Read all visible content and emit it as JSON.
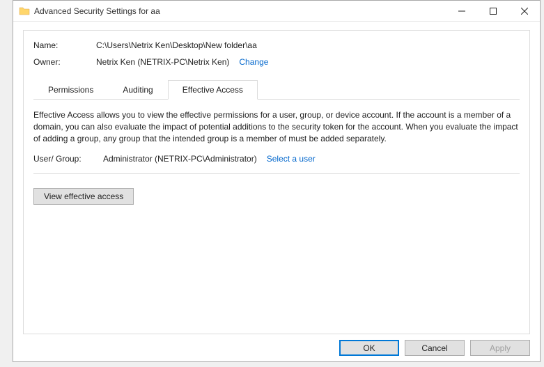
{
  "titlebar": {
    "title": "Advanced Security Settings for aa"
  },
  "header": {
    "name_label": "Name:",
    "name_value": "C:\\Users\\Netrix Ken\\Desktop\\New folder\\aa",
    "owner_label": "Owner:",
    "owner_value": "Netrix Ken (NETRIX-PC\\Netrix Ken)",
    "change_link": "Change"
  },
  "tabs": {
    "permissions": "Permissions",
    "auditing": "Auditing",
    "effective_access": "Effective Access"
  },
  "effective": {
    "description": "Effective Access allows you to view the effective permissions for a user, group, or device account. If the account is a member of a domain, you can also evaluate the impact of potential additions to the security token for the account. When you evaluate the impact of adding a group, any group that the intended group is a member of must be added separately.",
    "user_group_label": "User/ Group:",
    "user_group_value": "Administrator (NETRIX-PC\\Administrator)",
    "select_user_link": "Select a user",
    "view_button": "View effective access"
  },
  "buttons": {
    "ok": "OK",
    "cancel": "Cancel",
    "apply": "Apply"
  }
}
